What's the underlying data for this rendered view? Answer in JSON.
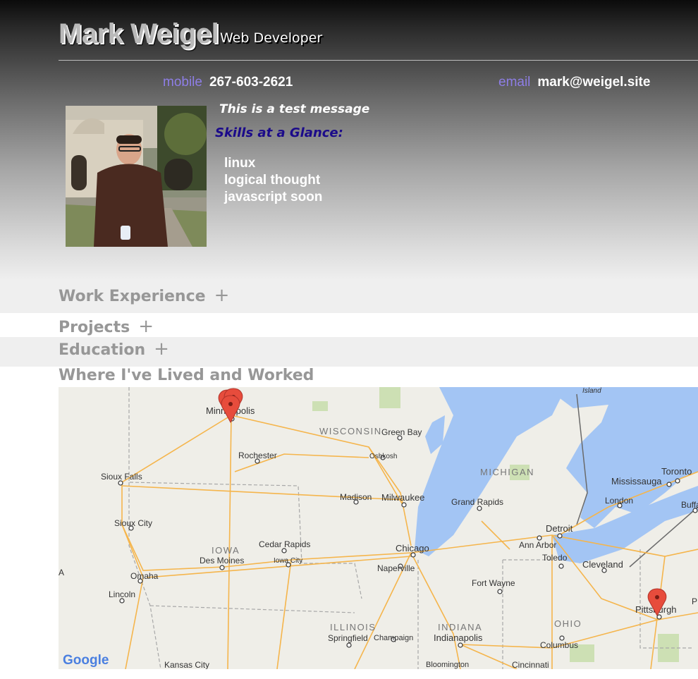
{
  "header": {
    "name": "Mark Weigel",
    "role": "Web Developer"
  },
  "contact": {
    "mobile_label": "mobile",
    "mobile": "267-603-2621",
    "email_label": "email",
    "email": "mark@weigel.site"
  },
  "profile": {
    "message": "This is a test message",
    "skills_title": "Skills at a Glance:",
    "skills": [
      "linux",
      "logical thought",
      "javascript soon"
    ]
  },
  "sections": {
    "work": "Work Experience",
    "projects": "Projects",
    "education": "Education",
    "lived": "Where I've Lived and Worked",
    "expand_symbol": "+"
  },
  "map": {
    "attribution": "Google",
    "states": [
      "WISCONSIN",
      "MICHIGAN",
      "IOWA",
      "ILLINOIS",
      "INDIANA",
      "OHIO"
    ],
    "cities": [
      "Minneapolis",
      "Green Bay",
      "Oshkosh",
      "Rochester",
      "Sioux Falls",
      "Madison",
      "Milwaukee",
      "Grand Rapids",
      "Toronto",
      "Mississauga",
      "London",
      "Buffa",
      "Sioux City",
      "Detroit",
      "Ann Arbor",
      "Cedar Rapids",
      "Chicago",
      "Toledo",
      "Cleveland",
      "Des Moines",
      "Iowa City",
      "Naperville",
      "Omaha",
      "Fort Wayne",
      "Lincoln",
      "Pittsburgh",
      "Springfield",
      "Champaign",
      "Indianapolis",
      "Columbus",
      "Kansas City",
      "Bloomington",
      "Cincinnati",
      "Island"
    ],
    "edge_letters": [
      "A",
      "P"
    ],
    "colors": {
      "water": "#a3c5f4",
      "land": "#efeee8",
      "road": "#f5b54c",
      "marker": "#e74c3c"
    }
  }
}
